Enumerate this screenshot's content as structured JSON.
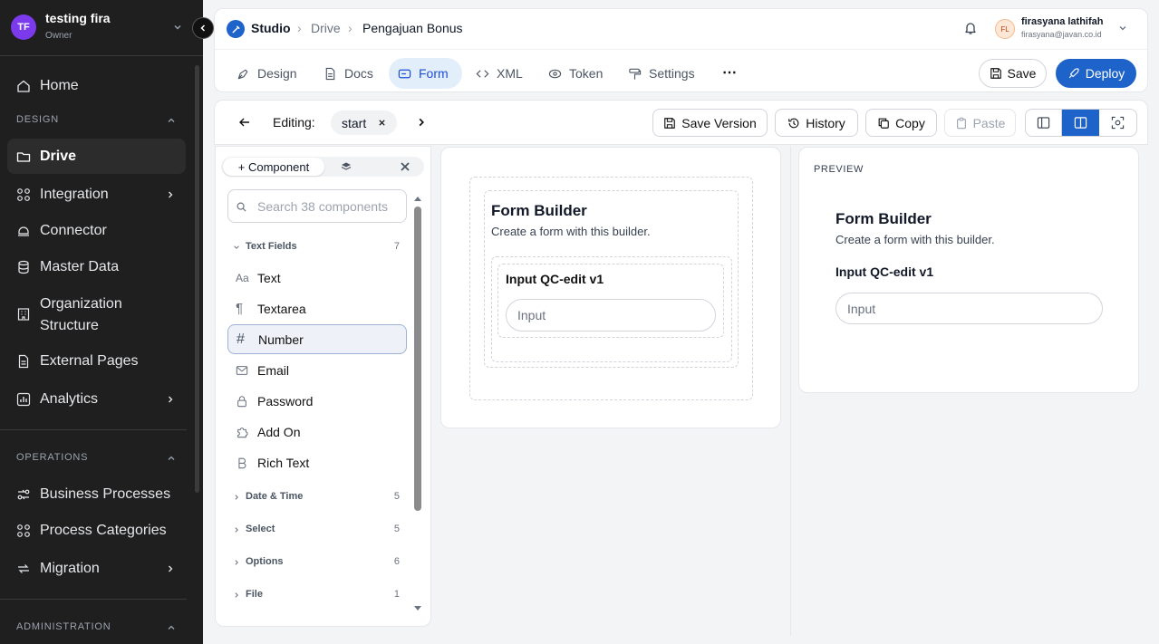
{
  "workspace": {
    "initials": "TF",
    "name": "testing fira",
    "role": "Owner",
    "avatar_color": "#7c3aed"
  },
  "sidebar": {
    "home": "Home",
    "sections": [
      {
        "title": "DESIGN"
      },
      {
        "title": "OPERATIONS"
      },
      {
        "title": "ADMINISTRATION"
      }
    ],
    "design_items": [
      {
        "label": "Drive",
        "icon": "folder-icon"
      },
      {
        "label": "Integration",
        "icon": "integration-icon"
      },
      {
        "label": "Connector",
        "icon": "connector-icon"
      },
      {
        "label": "Master Data",
        "icon": "database-icon"
      },
      {
        "label": "Organization Structure",
        "line1": "Organization",
        "line2": "Structure",
        "icon": "building-icon"
      },
      {
        "label": "External Pages",
        "icon": "file-icon"
      },
      {
        "label": "Analytics",
        "icon": "chart-icon"
      }
    ],
    "operations_items": [
      {
        "label": "Business Processes",
        "icon": "process-icon"
      },
      {
        "label": "Process Categories",
        "icon": "grid-icon"
      },
      {
        "label": "Migration",
        "icon": "migration-icon"
      }
    ]
  },
  "breadcrumb": {
    "app": "Studio",
    "level1": "Drive",
    "current": "Pengajuan Bonus"
  },
  "user": {
    "initials": "FL",
    "name": "firasyana lathifah",
    "email": "firasyana@javan.co.id"
  },
  "tabs": [
    {
      "label": "Design",
      "icon": "pen-icon"
    },
    {
      "label": "Docs",
      "icon": "doc-icon"
    },
    {
      "label": "Form",
      "icon": "form-icon"
    },
    {
      "label": "XML",
      "icon": "code-icon"
    },
    {
      "label": "Token",
      "icon": "token-icon"
    },
    {
      "label": "Settings",
      "icon": "settings-icon"
    }
  ],
  "actions": {
    "save": "Save",
    "deploy": "Deploy"
  },
  "editor": {
    "editing_label": "Editing:",
    "chip": "start",
    "save_version": "Save Version",
    "history": "History",
    "copy": "Copy",
    "paste": "Paste"
  },
  "components": {
    "tab_label": "+ Component",
    "search_placeholder": "Search 38 components",
    "groups": [
      {
        "label": "Text Fields",
        "count": "7"
      },
      {
        "label": "Date & Time",
        "count": "5"
      },
      {
        "label": "Select",
        "count": "5"
      },
      {
        "label": "Options",
        "count": "6"
      },
      {
        "label": "File",
        "count": "1"
      }
    ],
    "items": [
      {
        "label": "Text",
        "icon": "text-icon"
      },
      {
        "label": "Textarea",
        "icon": "paragraph-icon"
      },
      {
        "label": "Number",
        "icon": "hash-icon"
      },
      {
        "label": "Email",
        "icon": "mail-icon"
      },
      {
        "label": "Password",
        "icon": "lock-icon"
      },
      {
        "label": "Add On",
        "icon": "puzzle-icon"
      },
      {
        "label": "Rich Text",
        "icon": "bold-icon"
      }
    ]
  },
  "form": {
    "title": "Form Builder",
    "subtitle": "Create a form with this builder.",
    "field_label": "Input QC-edit v1",
    "field_placeholder": "Input"
  },
  "preview": {
    "label": "PREVIEW"
  },
  "colors": {
    "accent": "#1d63c9",
    "sidebar_bg": "#1f1f1f",
    "tab_active_bg": "#e3eefb"
  }
}
